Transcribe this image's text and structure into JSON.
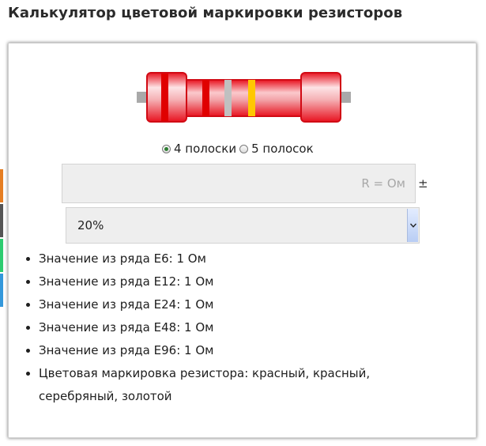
{
  "page": {
    "title": "Калькулятор цветовой маркировки резисторов"
  },
  "side_tabs": [
    "#e67e22",
    "#555555",
    "#2ecc71",
    "#3498db"
  ],
  "resistor": {
    "body_color": "#e8121f",
    "bands": [
      {
        "name": "красный",
        "color": "#e00000"
      },
      {
        "name": "красный",
        "color": "#e00000"
      },
      {
        "name": "серебряный",
        "color": "#c0c0c0"
      },
      {
        "name": "золотой",
        "color": "#ffc800"
      }
    ]
  },
  "mode": {
    "options": [
      {
        "label": "4 полоски",
        "checked": true
      },
      {
        "label": "5 полосок",
        "checked": false
      }
    ]
  },
  "value_input": {
    "placeholder": "R = Ом",
    "value": ""
  },
  "tolerance": {
    "plus_minus": "±",
    "selected": "20%"
  },
  "results": [
    "Значение из ряда Е6: 1 Ом",
    "Значение из ряда Е12: 1 Ом",
    "Значение из ряда Е24: 1 Ом",
    "Значение из ряда Е48: 1 Ом",
    "Значение из ряда Е96: 1 Ом",
    "Цветовая маркировка резистора: красный, красный, серебряный, золотой"
  ]
}
